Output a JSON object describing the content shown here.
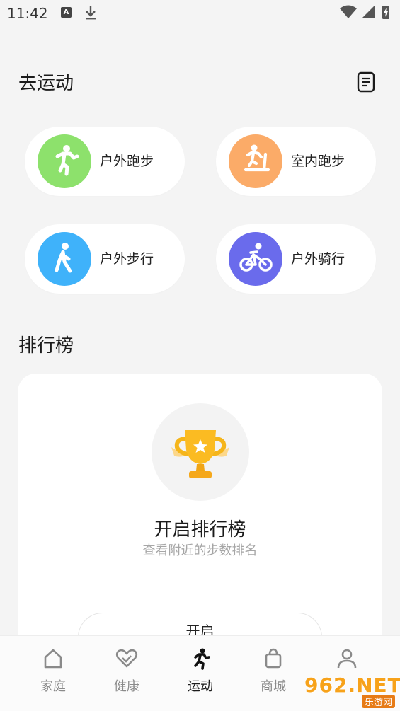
{
  "status_bar": {
    "time": "11:42",
    "notification_icon_letter": "A"
  },
  "header": {
    "title": "去运动",
    "doc_icon": "document-icon"
  },
  "sports": [
    {
      "label": "户外跑步",
      "color": "#8de16c",
      "icon": "running-icon"
    },
    {
      "label": "室内跑步",
      "color": "#fbab68",
      "icon": "treadmill-icon"
    },
    {
      "label": "户外步行",
      "color": "#3fb2fa",
      "icon": "walking-icon"
    },
    {
      "label": "户外骑行",
      "color": "#6a6bec",
      "icon": "cycling-icon"
    }
  ],
  "ranking": {
    "title": "排行榜",
    "heading": "开启排行榜",
    "subtitle": "查看附近的步数排名",
    "button_label": "开启"
  },
  "nav": [
    {
      "label": "家庭",
      "icon": "home-icon",
      "active": false
    },
    {
      "label": "健康",
      "icon": "heart-icon",
      "active": false
    },
    {
      "label": "运动",
      "icon": "running-icon",
      "active": true
    },
    {
      "label": "商城",
      "icon": "shopping-bag-icon",
      "active": false
    },
    {
      "label": "",
      "icon": "profile-icon",
      "active": false
    }
  ],
  "watermark": {
    "top": "962.NET",
    "bottom": "乐游网"
  }
}
